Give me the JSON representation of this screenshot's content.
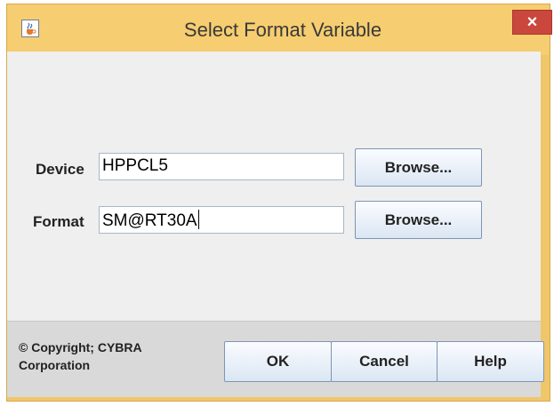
{
  "window": {
    "title": "Select Format Variable",
    "close_glyph": "×",
    "app_icon": "java-cup-icon"
  },
  "form": {
    "device_label": "Device",
    "device_value": "HPPCL5",
    "device_browse_label": "Browse...",
    "format_label": "Format",
    "format_value": "SM@RT30A",
    "format_browse_label": "Browse..."
  },
  "footer": {
    "copyright_line1": "© Copyright; CYBRA",
    "copyright_line2": "Corporation",
    "ok_label": "OK",
    "cancel_label": "Cancel",
    "help_label": "Help"
  },
  "colors": {
    "titlebar": "#f6cd70",
    "close_button": "#c9473d",
    "content_bg": "#efefef",
    "footer_bg": "#d9d9d9"
  }
}
